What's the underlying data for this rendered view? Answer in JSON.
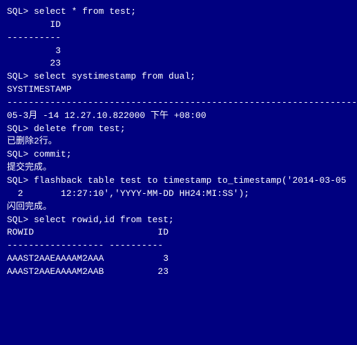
{
  "terminal": {
    "bg": "#000080",
    "fg": "#ffffff",
    "lines": [
      {
        "id": "cmd1",
        "text": "SQL> select * from test;",
        "type": "prompt"
      },
      {
        "id": "blank1",
        "text": "",
        "type": "blank"
      },
      {
        "id": "col1",
        "text": "        ID",
        "type": "output"
      },
      {
        "id": "sep1",
        "text": "----------",
        "type": "separator"
      },
      {
        "id": "val1",
        "text": "         3",
        "type": "output"
      },
      {
        "id": "val2",
        "text": "        23",
        "type": "output"
      },
      {
        "id": "blank2",
        "text": "",
        "type": "blank"
      },
      {
        "id": "cmd2",
        "text": "SQL> select systimestamp from dual;",
        "type": "prompt"
      },
      {
        "id": "blank3",
        "text": "",
        "type": "blank"
      },
      {
        "id": "col2",
        "text": "SYSTIMESTAMP",
        "type": "output"
      },
      {
        "id": "sep2",
        "text": "--------------------------------------------------------------------------------",
        "type": "separator"
      },
      {
        "id": "val3",
        "text": "05-3月 -14 12.27.10.822000 下午 +08:00",
        "type": "output"
      },
      {
        "id": "blank4",
        "text": "",
        "type": "blank"
      },
      {
        "id": "cmd3",
        "text": "SQL> delete from test;",
        "type": "prompt"
      },
      {
        "id": "blank5",
        "text": "",
        "type": "blank"
      },
      {
        "id": "out1",
        "text": "已删除2行。",
        "type": "output"
      },
      {
        "id": "blank6",
        "text": "",
        "type": "blank"
      },
      {
        "id": "cmd4",
        "text": "SQL> commit;",
        "type": "prompt"
      },
      {
        "id": "blank7",
        "text": "",
        "type": "blank"
      },
      {
        "id": "out2",
        "text": "提交完成。",
        "type": "output"
      },
      {
        "id": "blank8",
        "text": "",
        "type": "blank"
      },
      {
        "id": "cmd5a",
        "text": "SQL> flashback table test to timestamp to_timestamp('2014-03-05",
        "type": "prompt"
      },
      {
        "id": "cmd5b",
        "text": "  2       12:27:10','YYYY-MM-DD HH24:MI:SS');",
        "type": "continuation"
      },
      {
        "id": "blank9",
        "text": "",
        "type": "blank"
      },
      {
        "id": "out3",
        "text": "闪回完成。",
        "type": "output"
      },
      {
        "id": "blank10",
        "text": "",
        "type": "blank"
      },
      {
        "id": "cmd6",
        "text": "SQL> select rowid,id from test;",
        "type": "prompt"
      },
      {
        "id": "blank11",
        "text": "",
        "type": "blank"
      },
      {
        "id": "col3",
        "text": "ROWID                       ID",
        "type": "output"
      },
      {
        "id": "sep3",
        "text": "------------------ ----------",
        "type": "separator"
      },
      {
        "id": "blank12",
        "text": "",
        "type": "blank"
      },
      {
        "id": "row1a",
        "text": "AAAST2AAEAAAAM2AAA           3",
        "type": "output"
      },
      {
        "id": "row1b",
        "text": "AAAST2AAEAAAAM2AAB          23",
        "type": "output"
      }
    ]
  }
}
